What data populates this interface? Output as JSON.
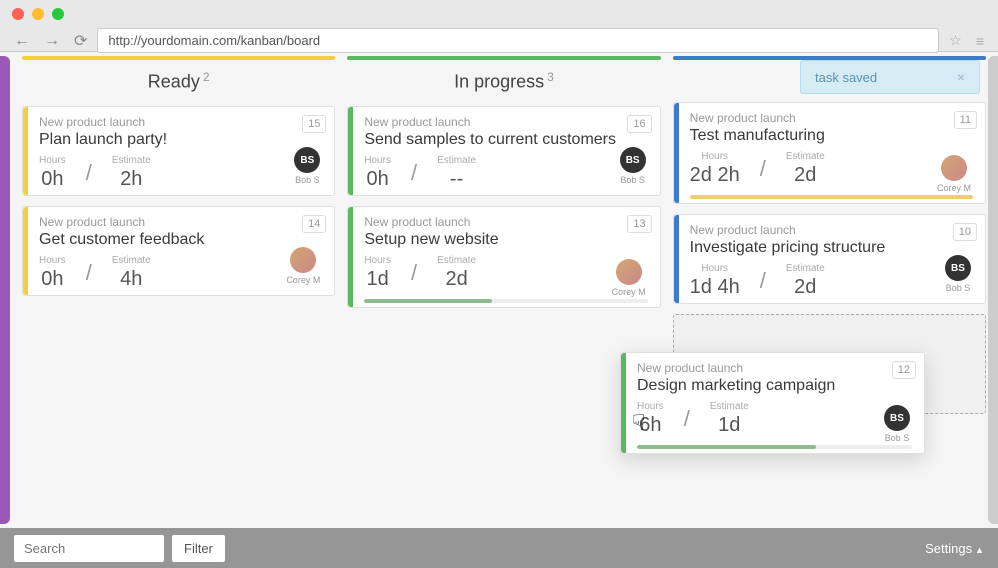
{
  "browser": {
    "url": "http://yourdomain.com/kanban/board"
  },
  "toast": {
    "message": "task saved",
    "close": "×"
  },
  "columns": [
    {
      "title": "Ready",
      "count": "2"
    },
    {
      "title": "In progress",
      "count": "3"
    },
    {
      "title": "",
      "count": ""
    }
  ],
  "labels": {
    "hours": "Hours",
    "estimate": "Estimate"
  },
  "cards": {
    "ready": [
      {
        "project": "New product launch",
        "title": "Plan launch party!",
        "num": "15",
        "hours": "0h",
        "estimate": "2h",
        "assignee": "Bob S",
        "initials": "BS",
        "avatar_type": "initials"
      },
      {
        "project": "New product launch",
        "title": "Get customer feedback",
        "num": "14",
        "hours": "0h",
        "estimate": "4h",
        "assignee": "Corey M",
        "initials": "",
        "avatar_type": "photo"
      }
    ],
    "progress": [
      {
        "project": "New product launch",
        "title": "Send samples to current customers",
        "num": "16",
        "hours": "0h",
        "estimate": "--",
        "assignee": "Bob S",
        "initials": "BS",
        "avatar_type": "initials"
      },
      {
        "project": "New product launch",
        "title": "Setup new website",
        "num": "13",
        "hours": "1d",
        "estimate": "2d",
        "assignee": "Corey M",
        "initials": "",
        "avatar_type": "photo",
        "progress": 45,
        "progress_color": "green"
      }
    ],
    "third": [
      {
        "project": "New product launch",
        "title": "Test manufacturing",
        "num": "11",
        "hours": "2d 2h",
        "estimate": "2d",
        "assignee": "Corey M",
        "initials": "",
        "avatar_type": "photo",
        "progress": 100,
        "progress_color": "orange"
      },
      {
        "project": "New product launch",
        "title": "Investigate pricing structure",
        "num": "10",
        "hours": "1d 4h",
        "estimate": "2d",
        "assignee": "Bob S",
        "initials": "BS",
        "avatar_type": "initials"
      }
    ],
    "dragging": {
      "project": "New product launch",
      "title": "Design marketing campaign",
      "num": "12",
      "hours": "6h",
      "estimate": "1d",
      "assignee": "Bob S",
      "initials": "BS",
      "avatar_type": "initials",
      "progress": 65,
      "progress_color": "green"
    }
  },
  "footer": {
    "search_placeholder": "Search",
    "filter": "Filter",
    "settings": "Settings"
  }
}
